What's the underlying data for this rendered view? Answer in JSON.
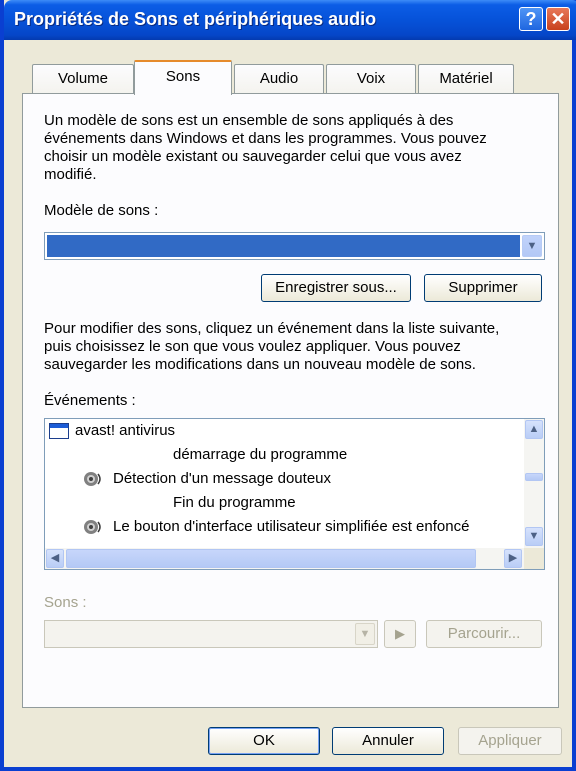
{
  "window": {
    "title": "Propriétés de Sons et périphériques audio",
    "help_glyph": "?",
    "close_glyph": "✕"
  },
  "tabs": [
    {
      "label": "Volume",
      "active": false
    },
    {
      "label": "Sons",
      "active": true
    },
    {
      "label": "Audio",
      "active": false
    },
    {
      "label": "Voix",
      "active": false
    },
    {
      "label": "Matériel",
      "active": false
    }
  ],
  "intro_text": [
    "Un modèle de sons est un ensemble de sons appliqués à des",
    "événements dans Windows et dans les programmes. Vous pouvez",
    "choisir un modèle existant ou sauvegarder celui que vous avez",
    "modifié."
  ],
  "scheme": {
    "label": "Modèle de sons :",
    "value": "",
    "save_as_label": "Enregistrer sous...",
    "delete_label": "Supprimer"
  },
  "events_text": [
    "Pour modifier des sons, cliquez un événement dans la liste suivante,",
    "puis choisissez le son que vous voulez appliquer. Vous pouvez",
    "sauvegarder les modifications dans un nouveau modèle de sons."
  ],
  "events": {
    "label": "Événements :",
    "items": [
      {
        "label": "avast! antivirus",
        "icon": "program-window-icon"
      },
      {
        "label": "démarrage du programme",
        "icon": ""
      },
      {
        "label": "Détection d'un message douteux",
        "icon": "speaker-icon"
      },
      {
        "label": "Fin du programme",
        "icon": ""
      },
      {
        "label": "Le bouton d'interface utilisateur simplifiée est enfoncé",
        "icon": "speaker-icon"
      }
    ]
  },
  "sounds": {
    "label": "Sons :",
    "value": "",
    "browse_label": "Parcourir..."
  },
  "footer": {
    "ok_label": "OK",
    "cancel_label": "Annuler",
    "apply_label": "Appliquer"
  },
  "colors": {
    "titlebar": "#0652d9",
    "selection": "#316ac5",
    "dialog_bg": "#ece9d8",
    "tab_highlight": "#e68b2c"
  }
}
